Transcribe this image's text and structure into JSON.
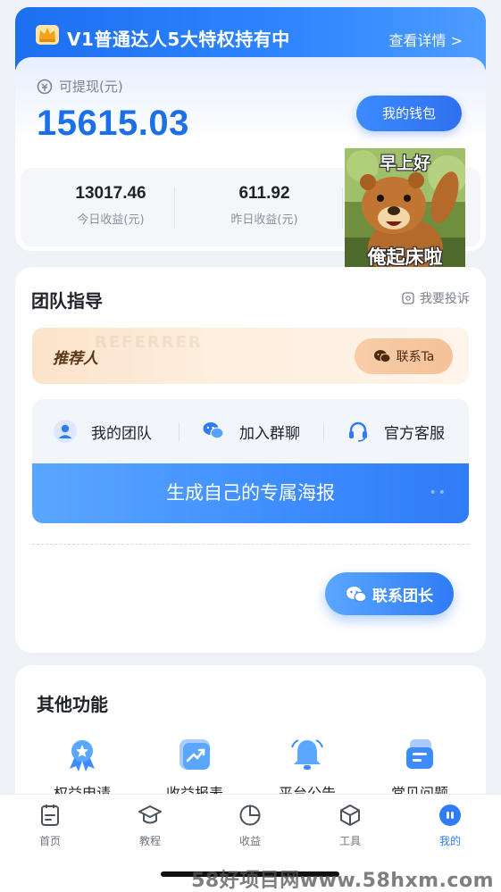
{
  "vip_banner": {
    "title": "V1普通达人5大特权持有中",
    "detail": "查看详情 >"
  },
  "wallet": {
    "label": "可提现(元)",
    "balance": "15615.03",
    "button": "我的钱包",
    "stats": [
      {
        "value": "13017.46",
        "label": "今日收益(元)"
      },
      {
        "value": "611.92",
        "label": "昨日收益(元)"
      }
    ]
  },
  "sticker": {
    "top_text": "早上好",
    "bottom_text": "俺起床啦"
  },
  "team": {
    "heading": "团队指导",
    "complaint": "我要投诉",
    "referrer_label": "推荐人",
    "referrer_ghost": "REFERRER",
    "contact_ta": "联系Ta",
    "actions": [
      {
        "label": "我的团队",
        "icon": "user-icon"
      },
      {
        "label": "加入群聊",
        "icon": "wechat-icon"
      },
      {
        "label": "官方客服",
        "icon": "headset-icon"
      }
    ],
    "poster_button": "生成自己的专属海报",
    "contact_leader": "联系团长"
  },
  "other": {
    "heading": "其他功能",
    "items": [
      {
        "label": "权益申请",
        "icon": "ribbon-badge-icon"
      },
      {
        "label": "收益报表",
        "icon": "trend-chart-icon"
      },
      {
        "label": "平台公告",
        "icon": "bell-icon"
      },
      {
        "label": "常见问题",
        "icon": "faq-icon"
      }
    ]
  },
  "tabbar": {
    "items": [
      {
        "label": "首页",
        "icon": "home-doc-icon"
      },
      {
        "label": "教程",
        "icon": "graduation-cap-icon"
      },
      {
        "label": "收益",
        "icon": "pie-chart-icon"
      },
      {
        "label": "工具",
        "icon": "cube-icon"
      },
      {
        "label": "我的",
        "icon": "profile-icon"
      }
    ],
    "active_index": 4
  },
  "watermark": "58好项目网www.58hxm.com",
  "colors": {
    "primary": "#2f7cf6",
    "balance": "#1b6fe8",
    "referrer_bg": "#fbe3cb"
  }
}
